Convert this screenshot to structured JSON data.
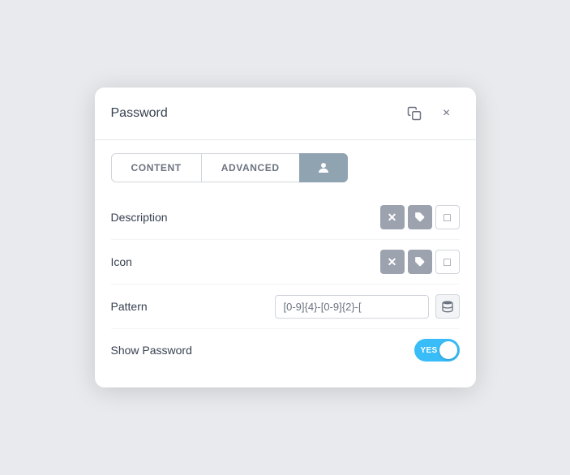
{
  "dialog": {
    "title": "Password",
    "copy_label": "copy",
    "close_label": "×"
  },
  "tabs": {
    "content_label": "CONTENT",
    "advanced_label": "ADVANCED",
    "icon_label": "person-icon"
  },
  "fields": {
    "description": {
      "label": "Description",
      "close_aria": "clear",
      "tag_aria": "tag",
      "square_aria": "expand"
    },
    "icon": {
      "label": "Icon",
      "close_aria": "clear",
      "tag_aria": "tag",
      "square_aria": "expand"
    },
    "pattern": {
      "label": "Pattern",
      "value": "[0-9]{4}-[0-9]{2}-[",
      "stack_aria": "stack"
    },
    "show_password": {
      "label": "Show Password",
      "toggle_state": "YES"
    }
  }
}
